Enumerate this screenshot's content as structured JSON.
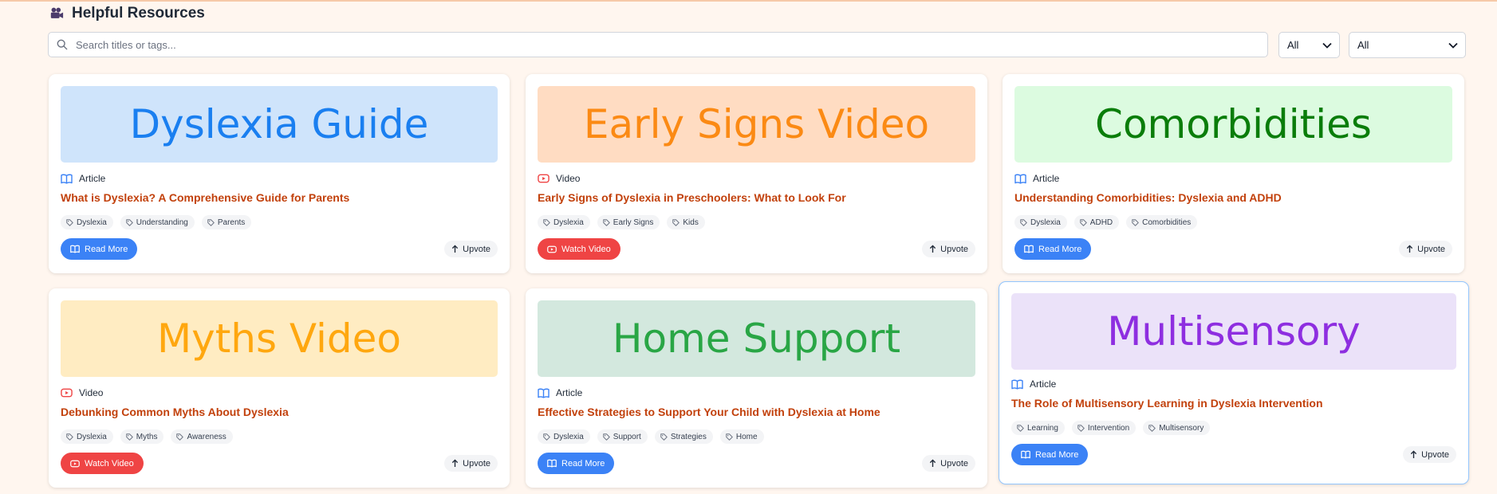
{
  "header": {
    "title": "Helpful Resources",
    "icon": "video-camera-icon"
  },
  "search": {
    "placeholder": "Search titles or tags..."
  },
  "filters": [
    {
      "value": "All"
    },
    {
      "value": "All"
    }
  ],
  "colors": {
    "title": "#c2410c",
    "read_button": "#3b82f6",
    "watch_button": "#ef4444",
    "background": "#fff6ef"
  },
  "cards": [
    {
      "banner": "Dyslexia Guide",
      "banner_bg": "#cfe4fb",
      "banner_color": "#1a7ff0",
      "type": "Article",
      "type_icon": "book-icon",
      "title": "What is Dyslexia? A Comprehensive Guide for Parents",
      "tags": [
        "Dyslexia",
        "Understanding",
        "Parents"
      ],
      "action": "Read More",
      "upvote": "Upvote"
    },
    {
      "banner": "Early Signs Video",
      "banner_bg": "#ffdcc2",
      "banner_color": "#fb8a14",
      "type": "Video",
      "type_icon": "youtube-icon",
      "title": "Early Signs of Dyslexia in Preschoolers: What to Look For",
      "tags": [
        "Dyslexia",
        "Early Signs",
        "Kids"
      ],
      "action": "Watch Video",
      "upvote": "Upvote"
    },
    {
      "banner": "Comorbidities",
      "banner_bg": "#dcfbe0",
      "banner_color": "#0a7d0a",
      "type": "Article",
      "type_icon": "book-icon",
      "title": "Understanding Comorbidities: Dyslexia and ADHD",
      "tags": [
        "Dyslexia",
        "ADHD",
        "Comorbidities"
      ],
      "action": "Read More",
      "upvote": "Upvote"
    },
    {
      "banner": "Myths Video",
      "banner_bg": "#ffecc2",
      "banner_color": "#ffa70f",
      "type": "Video",
      "type_icon": "youtube-icon",
      "title": "Debunking Common Myths About Dyslexia",
      "tags": [
        "Dyslexia",
        "Myths",
        "Awareness"
      ],
      "action": "Watch Video",
      "upvote": "Upvote"
    },
    {
      "banner": "Home Support",
      "banner_bg": "#d3e8de",
      "banner_color": "#29a645",
      "type": "Article",
      "type_icon": "book-icon",
      "title": "Effective Strategies to Support Your Child with Dyslexia at Home",
      "tags": [
        "Dyslexia",
        "Support",
        "Strategies",
        "Home"
      ],
      "action": "Read More",
      "upvote": "Upvote"
    },
    {
      "banner": "Multisensory",
      "banner_bg": "#ebe2f9",
      "banner_color": "#8e2ee0",
      "type": "Article",
      "type_icon": "book-icon",
      "title": "The Role of Multisensory Learning in Dyslexia Intervention",
      "tags": [
        "Learning",
        "Intervention",
        "Multisensory"
      ],
      "action": "Read More",
      "upvote": "Upvote"
    }
  ]
}
